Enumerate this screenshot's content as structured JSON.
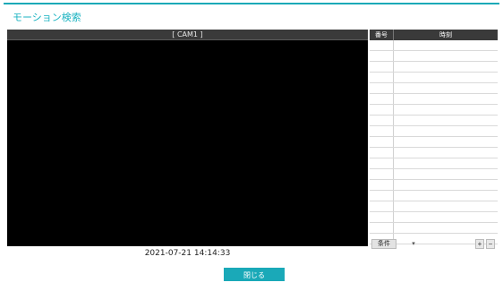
{
  "window": {
    "title": "モーション検索"
  },
  "video": {
    "camera_label": "[ CAM1 ]",
    "timestamp": "2021-07-21   14:14:33"
  },
  "list": {
    "columns": {
      "number": "番号",
      "time": "時刻"
    },
    "rows": [
      "",
      "",
      "",
      "",
      "",
      "",
      "",
      "",
      "",
      "",
      "",
      "",
      "",
      "",
      "",
      "",
      "",
      "",
      ""
    ]
  },
  "footer": {
    "condition_label": "条件",
    "condition_arrow": "▾",
    "zoom_in": "+",
    "zoom_out": "−"
  },
  "actions": {
    "close_label": "閉じる"
  },
  "colors": {
    "accent": "#1aa9b8",
    "header_bg": "#3a3a3a",
    "video_bg": "#000000"
  }
}
